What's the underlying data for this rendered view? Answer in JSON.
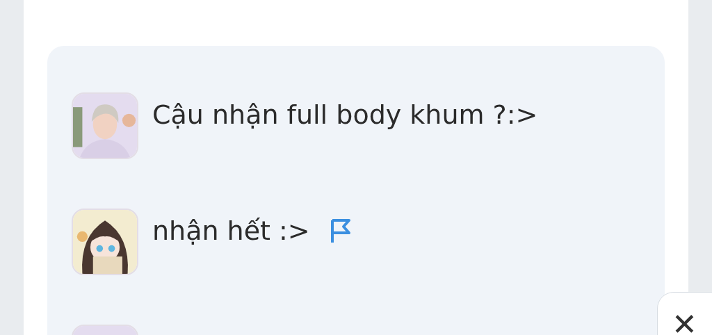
{
  "comments": [
    {
      "text": "Cậu nhận full body khum ?:>",
      "flag_shown": false
    },
    {
      "text": "nhận hết :>",
      "flag_shown": true
    }
  ],
  "close_button": {
    "label": "✕"
  }
}
